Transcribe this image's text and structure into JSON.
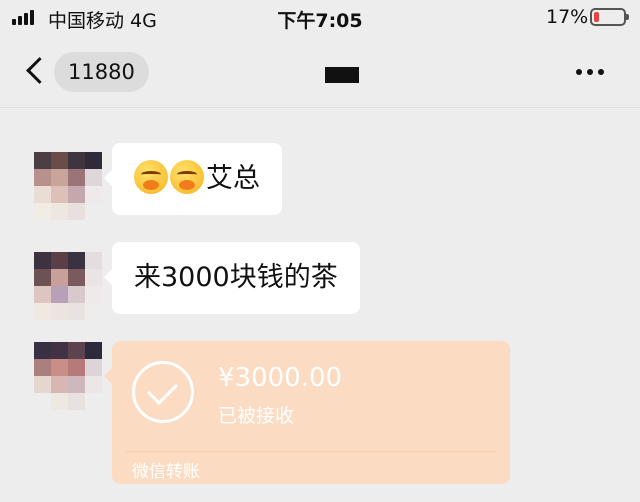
{
  "status_bar": {
    "carrier": "中国移动  4G",
    "time": "下午7:05",
    "battery": "17%",
    "battery_level": 0.17,
    "battery_color": "#e64340"
  },
  "nav": {
    "back_icon": "chevron-left-icon",
    "back_count": "11880",
    "more_icon": "more-dots-icon"
  },
  "messages": [
    {
      "type": "text",
      "emoji_count": 2,
      "emoji_icon": "face-emoji-icon",
      "text": "艾总"
    },
    {
      "type": "text",
      "text": "来3000块钱的茶"
    },
    {
      "type": "transfer",
      "amount": "¥3000.00",
      "status": "已被接收",
      "label": "微信转账",
      "icon": "check-circle-icon",
      "color": "#fbdcc3"
    }
  ]
}
